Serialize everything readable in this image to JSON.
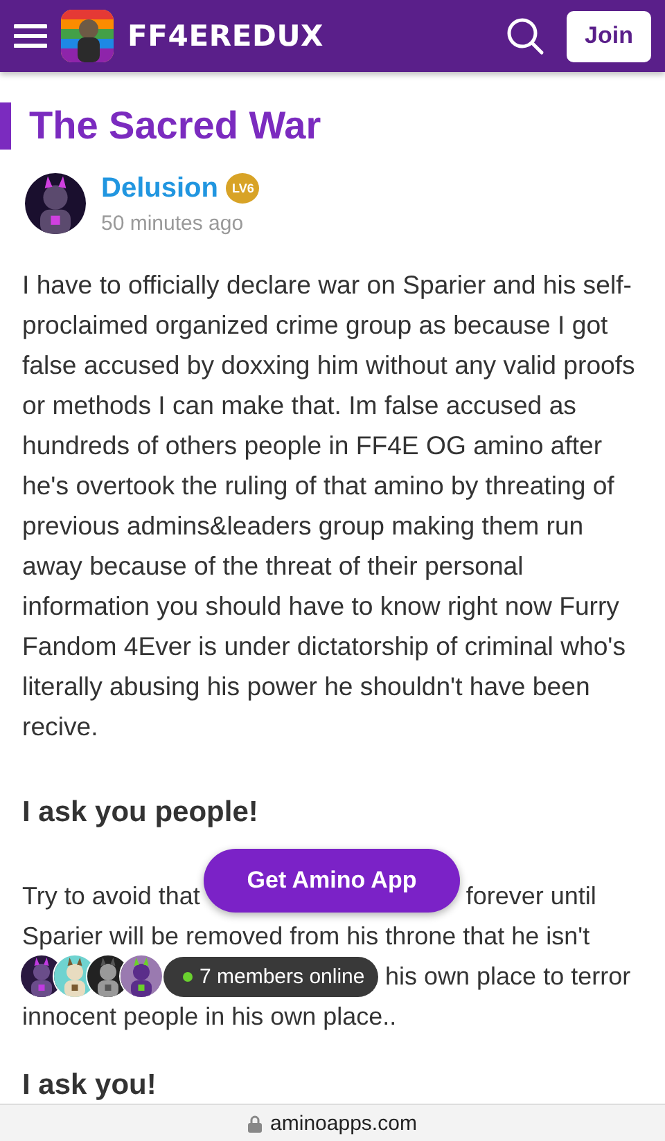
{
  "header": {
    "community": "FF4EREDUX",
    "join_label": "Join"
  },
  "post": {
    "title": "The Sacred War",
    "author": "Delusion",
    "level_badge": "LV6",
    "time": "50 minutes ago",
    "paragraph": "I have to officially declare war on Sparier and his self-proclaimed organized crime group as because I got false accused by doxxing him without any valid proofs or methods I can make that. Im false accused as hundreds of others people in FF4E OG amino after he's overtook the ruling of that amino by threating of previous admins&leaders group making them run away because of the threat of their personal information you should have to know right now Furry Fandom 4Ever is under dictatorship of criminal who's literally abusing his power he shouldn't have been recive.",
    "heading_1": "I ask you people!",
    "lines": [
      {
        "start": "Try to avoid that",
        "end": "forever until"
      },
      {
        "start": "Sparier will be removed from his throne that he isn't"
      },
      {
        "end": "his own place to terror"
      },
      {
        "start": "innocent people in his own place.."
      }
    ],
    "heading_2": "I ask you!"
  },
  "get_app_label": "Get Amino App",
  "online": {
    "label": "7 members online"
  },
  "address_bar": {
    "url": "aminoapps.com"
  }
}
